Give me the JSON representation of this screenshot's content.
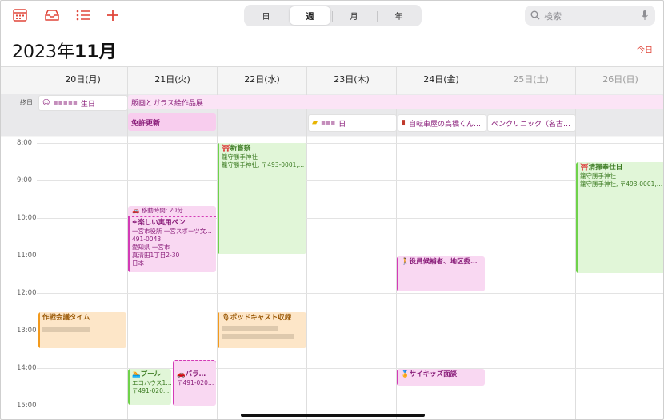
{
  "toolbar": {
    "segments": [
      "日",
      "週",
      "月",
      "年"
    ],
    "active_segment": "週",
    "search_placeholder": "検索"
  },
  "header": {
    "year": "2023年",
    "month": "11月",
    "today_label": "今日"
  },
  "days": [
    {
      "label": "20日(月)",
      "weekend": false
    },
    {
      "label": "21日(火)",
      "weekend": false
    },
    {
      "label": "22日(水)",
      "weekend": false
    },
    {
      "label": "23日(木)",
      "weekend": false
    },
    {
      "label": "24日(金)",
      "weekend": false
    },
    {
      "label": "25日(土)",
      "weekend": true
    },
    {
      "label": "26日(日)",
      "weekend": true
    }
  ],
  "allday": {
    "label": "終日",
    "events": [
      {
        "title": "生日",
        "icon": "birthday-icon"
      },
      {
        "title": "版画とガラス絵作品展"
      },
      {
        "title": "免許更新"
      },
      {
        "title": "日",
        "icon": "folder-icon"
      },
      {
        "title": "自転車屋の高橋くん…",
        "icon": "book-icon"
      },
      {
        "title": "ペンクリニック（名古…"
      }
    ]
  },
  "hours": [
    "8:00",
    "9:00",
    "10:00",
    "11:00",
    "12:00",
    "13:00",
    "14:00",
    "15:00"
  ],
  "events": {
    "shinjosai": {
      "title": "新嘗祭",
      "lines": [
        "籠守勝手神社",
        "籠守勝手神社, 〒493-0001,…"
      ]
    },
    "seisou": {
      "title": "清掃奉仕日",
      "lines": [
        "籠守勝手神社",
        "籠守勝手神社, 〒493-0001,…"
      ]
    },
    "travel": {
      "title": "移動時間: 20分"
    },
    "pen": {
      "title": "楽しい実用ペン",
      "lines": [
        "一宮市役所 一宮スポーツ文…",
        "491-0043",
        "愛知県 一宮市",
        "真清田1丁目2-30",
        "日本"
      ]
    },
    "yakuin": {
      "title": "役員候補者、地区委…"
    },
    "sakusen": {
      "title": "作戦会議タイム"
    },
    "podcast": {
      "title": "ポッドキャスト収録"
    },
    "pool": {
      "title": "プール",
      "lines": [
        "エコハウス1…",
        "〒491-020…"
      ]
    },
    "bara": {
      "title": "バラ…",
      "lines": [
        "〒491-020…"
      ]
    },
    "saikids": {
      "title": "サイキッズ面談"
    }
  }
}
